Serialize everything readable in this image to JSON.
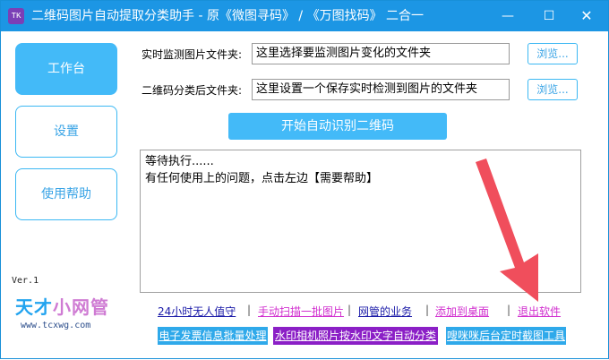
{
  "window": {
    "title": "二维码图片自动提取分类助手 - 原《微图寻码》 / 《万图找码》 二合一",
    "app_icon_glyph": "TK",
    "controls": {
      "minimize": "—",
      "maximize": "☐",
      "close": "✕"
    }
  },
  "sidebar": {
    "items": [
      {
        "label": "工作台"
      },
      {
        "label": "设置"
      },
      {
        "label": "使用帮助"
      }
    ],
    "version": "Ver.1",
    "logo": {
      "text_main": "天才",
      "text_highlight": "小网管",
      "url": "www.tcxwg.com"
    }
  },
  "form": {
    "monitor_label": "实时监测图片文件夹:",
    "monitor_value": "这里选择要监测图片变化的文件夹",
    "output_label": "二维码分类后文件夹:",
    "output_value": "这里设置一个保存实时检测到图片的文件夹",
    "browse_label": "浏览...",
    "start_button": "开始自动识别二维码"
  },
  "log": {
    "lines": [
      "等待执行......",
      "有任何使用上的问题，点击左边【需要帮助】"
    ]
  },
  "links": [
    {
      "label": "24小时无人值守",
      "color": "#1a1aa8"
    },
    {
      "label": "手动扫描一批图片",
      "color": "#d12fcf"
    },
    {
      "label": "网管的业务",
      "color": "#1a1aa8"
    },
    {
      "label": "添加到桌面",
      "color": "#d12fcf"
    },
    {
      "label": "退出软件",
      "color": "#d12fcf"
    }
  ],
  "separator": "|",
  "tools": [
    {
      "label": "电子发票信息批量处理",
      "color": "#2fa9ea"
    },
    {
      "label": "水印相机照片按水印文字自动分类",
      "color": "#8b1fc6"
    },
    {
      "label": "嗖咪咪后台定时截图工具",
      "color": "#2fa9ea"
    }
  ],
  "colors": {
    "titlebar": "#1c96e4",
    "accent": "#43baf8",
    "arrow": "#f04e5c"
  }
}
